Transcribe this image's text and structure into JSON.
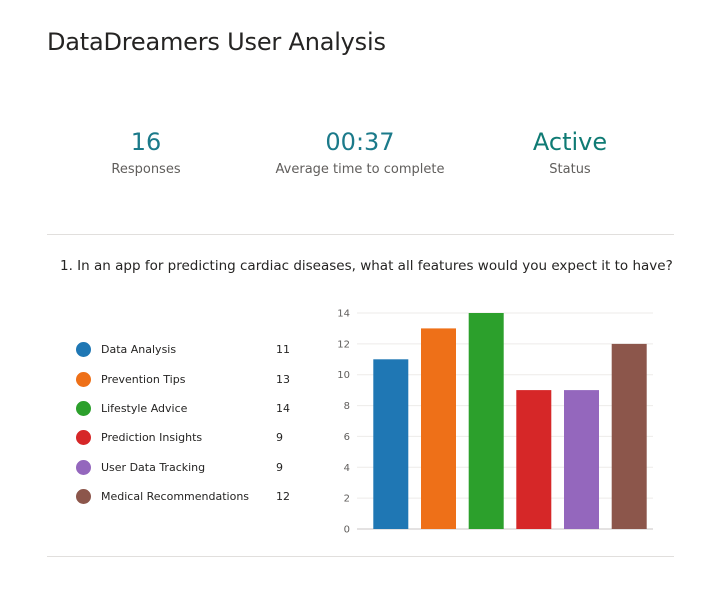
{
  "title": "DataDreamers User Analysis",
  "stats": [
    {
      "value": "16",
      "label": "Responses"
    },
    {
      "value": "00:37",
      "label": "Average time to complete"
    },
    {
      "value": "Active",
      "label": "Status"
    }
  ],
  "question": "1.  In an app for predicting cardiac diseases, what all features would you expect it to have?",
  "legend": [
    {
      "label": "Data Analysis",
      "count": "11",
      "color": "#1f77b4"
    },
    {
      "label": "Prevention Tips",
      "count": "13",
      "color": "#ee7018"
    },
    {
      "label": "Lifestyle Advice",
      "count": "14",
      "color": "#2ca02c"
    },
    {
      "label": "Prediction Insights",
      "count": "9",
      "color": "#d62728"
    },
    {
      "label": "User Data Tracking",
      "count": "9",
      "color": "#9467bd"
    },
    {
      "label": "Medical Recommendations",
      "count": "12",
      "color": "#8c564b"
    }
  ],
  "chart_data": {
    "type": "bar",
    "categories": [
      "Data Analysis",
      "Prevention Tips",
      "Lifestyle Advice",
      "Prediction Insights",
      "User Data Tracking",
      "Medical Recommendations"
    ],
    "values": [
      11,
      13,
      14,
      9,
      9,
      12
    ],
    "colors": [
      "#1f77b4",
      "#ee7018",
      "#2ca02c",
      "#d62728",
      "#9467bd",
      "#8c564b"
    ],
    "ylim": [
      0,
      14
    ],
    "yticks": [
      "0",
      "2",
      "4",
      "6",
      "8",
      "10",
      "12",
      "14"
    ],
    "grid": true
  }
}
